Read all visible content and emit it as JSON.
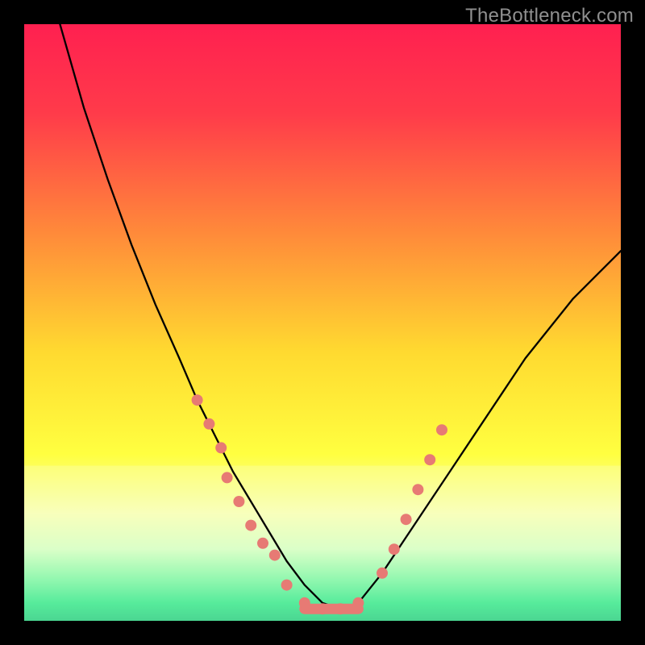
{
  "watermark": "TheBottleneck.com",
  "chart_data": {
    "type": "line",
    "title": "",
    "xlabel": "",
    "ylabel": "",
    "xlim": [
      0,
      100
    ],
    "ylim": [
      0,
      100
    ],
    "series": [
      {
        "name": "curve",
        "x": [
          6,
          10,
          14,
          18,
          22,
          26,
          29,
          32,
          35,
          38,
          41,
          44,
          47,
          50,
          53,
          56,
          60,
          64,
          68,
          72,
          76,
          80,
          84,
          88,
          92,
          96,
          100
        ],
        "values": [
          100,
          86,
          74,
          63,
          53,
          44,
          37,
          31,
          25,
          20,
          15,
          10,
          6,
          3,
          2,
          3,
          8,
          14,
          20,
          26,
          32,
          38,
          44,
          49,
          54,
          58,
          62
        ]
      }
    ],
    "markers": [
      {
        "x": 29,
        "y": 37
      },
      {
        "x": 31,
        "y": 33
      },
      {
        "x": 33,
        "y": 29
      },
      {
        "x": 34,
        "y": 24
      },
      {
        "x": 36,
        "y": 20
      },
      {
        "x": 38,
        "y": 16
      },
      {
        "x": 40,
        "y": 13
      },
      {
        "x": 42,
        "y": 11
      },
      {
        "x": 44,
        "y": 6
      },
      {
        "x": 47,
        "y": 3
      },
      {
        "x": 50,
        "y": 2
      },
      {
        "x": 53,
        "y": 2
      },
      {
        "x": 56,
        "y": 3
      },
      {
        "x": 60,
        "y": 8
      },
      {
        "x": 62,
        "y": 12
      },
      {
        "x": 64,
        "y": 17
      },
      {
        "x": 66,
        "y": 22
      },
      {
        "x": 68,
        "y": 27
      },
      {
        "x": 70,
        "y": 32
      }
    ],
    "gradient_stops": [
      {
        "offset": 0.0,
        "color": "#ff2050"
      },
      {
        "offset": 0.15,
        "color": "#ff3b4a"
      },
      {
        "offset": 0.35,
        "color": "#ff8a3a"
      },
      {
        "offset": 0.55,
        "color": "#ffda30"
      },
      {
        "offset": 0.72,
        "color": "#ffff40"
      },
      {
        "offset": 0.82,
        "color": "#f7ffb0"
      },
      {
        "offset": 0.88,
        "color": "#d0ffc0"
      },
      {
        "offset": 0.93,
        "color": "#70f5a0"
      },
      {
        "offset": 0.97,
        "color": "#20e585"
      },
      {
        "offset": 1.0,
        "color": "#10c878"
      }
    ],
    "bottom_highlight": {
      "y_from": 74,
      "y_to": 100,
      "color": "#fdffdf",
      "opacity": 0.25
    }
  }
}
